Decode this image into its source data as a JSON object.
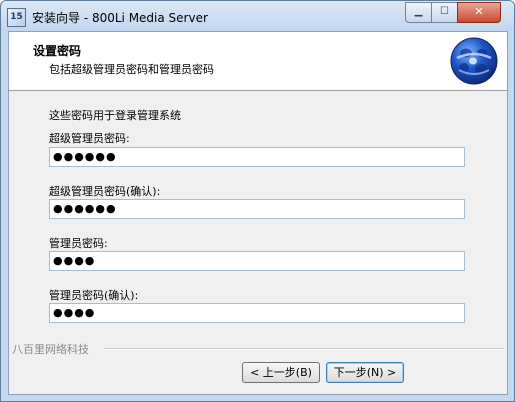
{
  "window": {
    "title": "安装向导 - 800Li Media Server",
    "icon": "installer-app-icon",
    "icon_text": "15"
  },
  "header": {
    "title": "设置密码",
    "subtitle": "包括超级管理员密码和管理员密码",
    "logo": "globe-logo-icon"
  },
  "body": {
    "description": "这些密码用于登录管理系统",
    "fields": [
      {
        "label": "超级管理员密码:",
        "value": "●●●●●●"
      },
      {
        "label": "超级管理员密码(确认):",
        "value": "●●●●●●"
      },
      {
        "label": "管理员密码:",
        "value": "●●●●"
      },
      {
        "label": "管理员密码(确认):",
        "value": "●●●●"
      }
    ]
  },
  "footer": {
    "brand": "八百里网络科技",
    "back_label": "< 上一步(B)",
    "next_label": "下一步(N) >"
  },
  "colors": {
    "title_bar": "#c5d9ee",
    "close_button": "#c74a31",
    "input_border": "#a6bed4",
    "header_bg": "#ffffff",
    "panel_bg": "#f0f0f0"
  }
}
